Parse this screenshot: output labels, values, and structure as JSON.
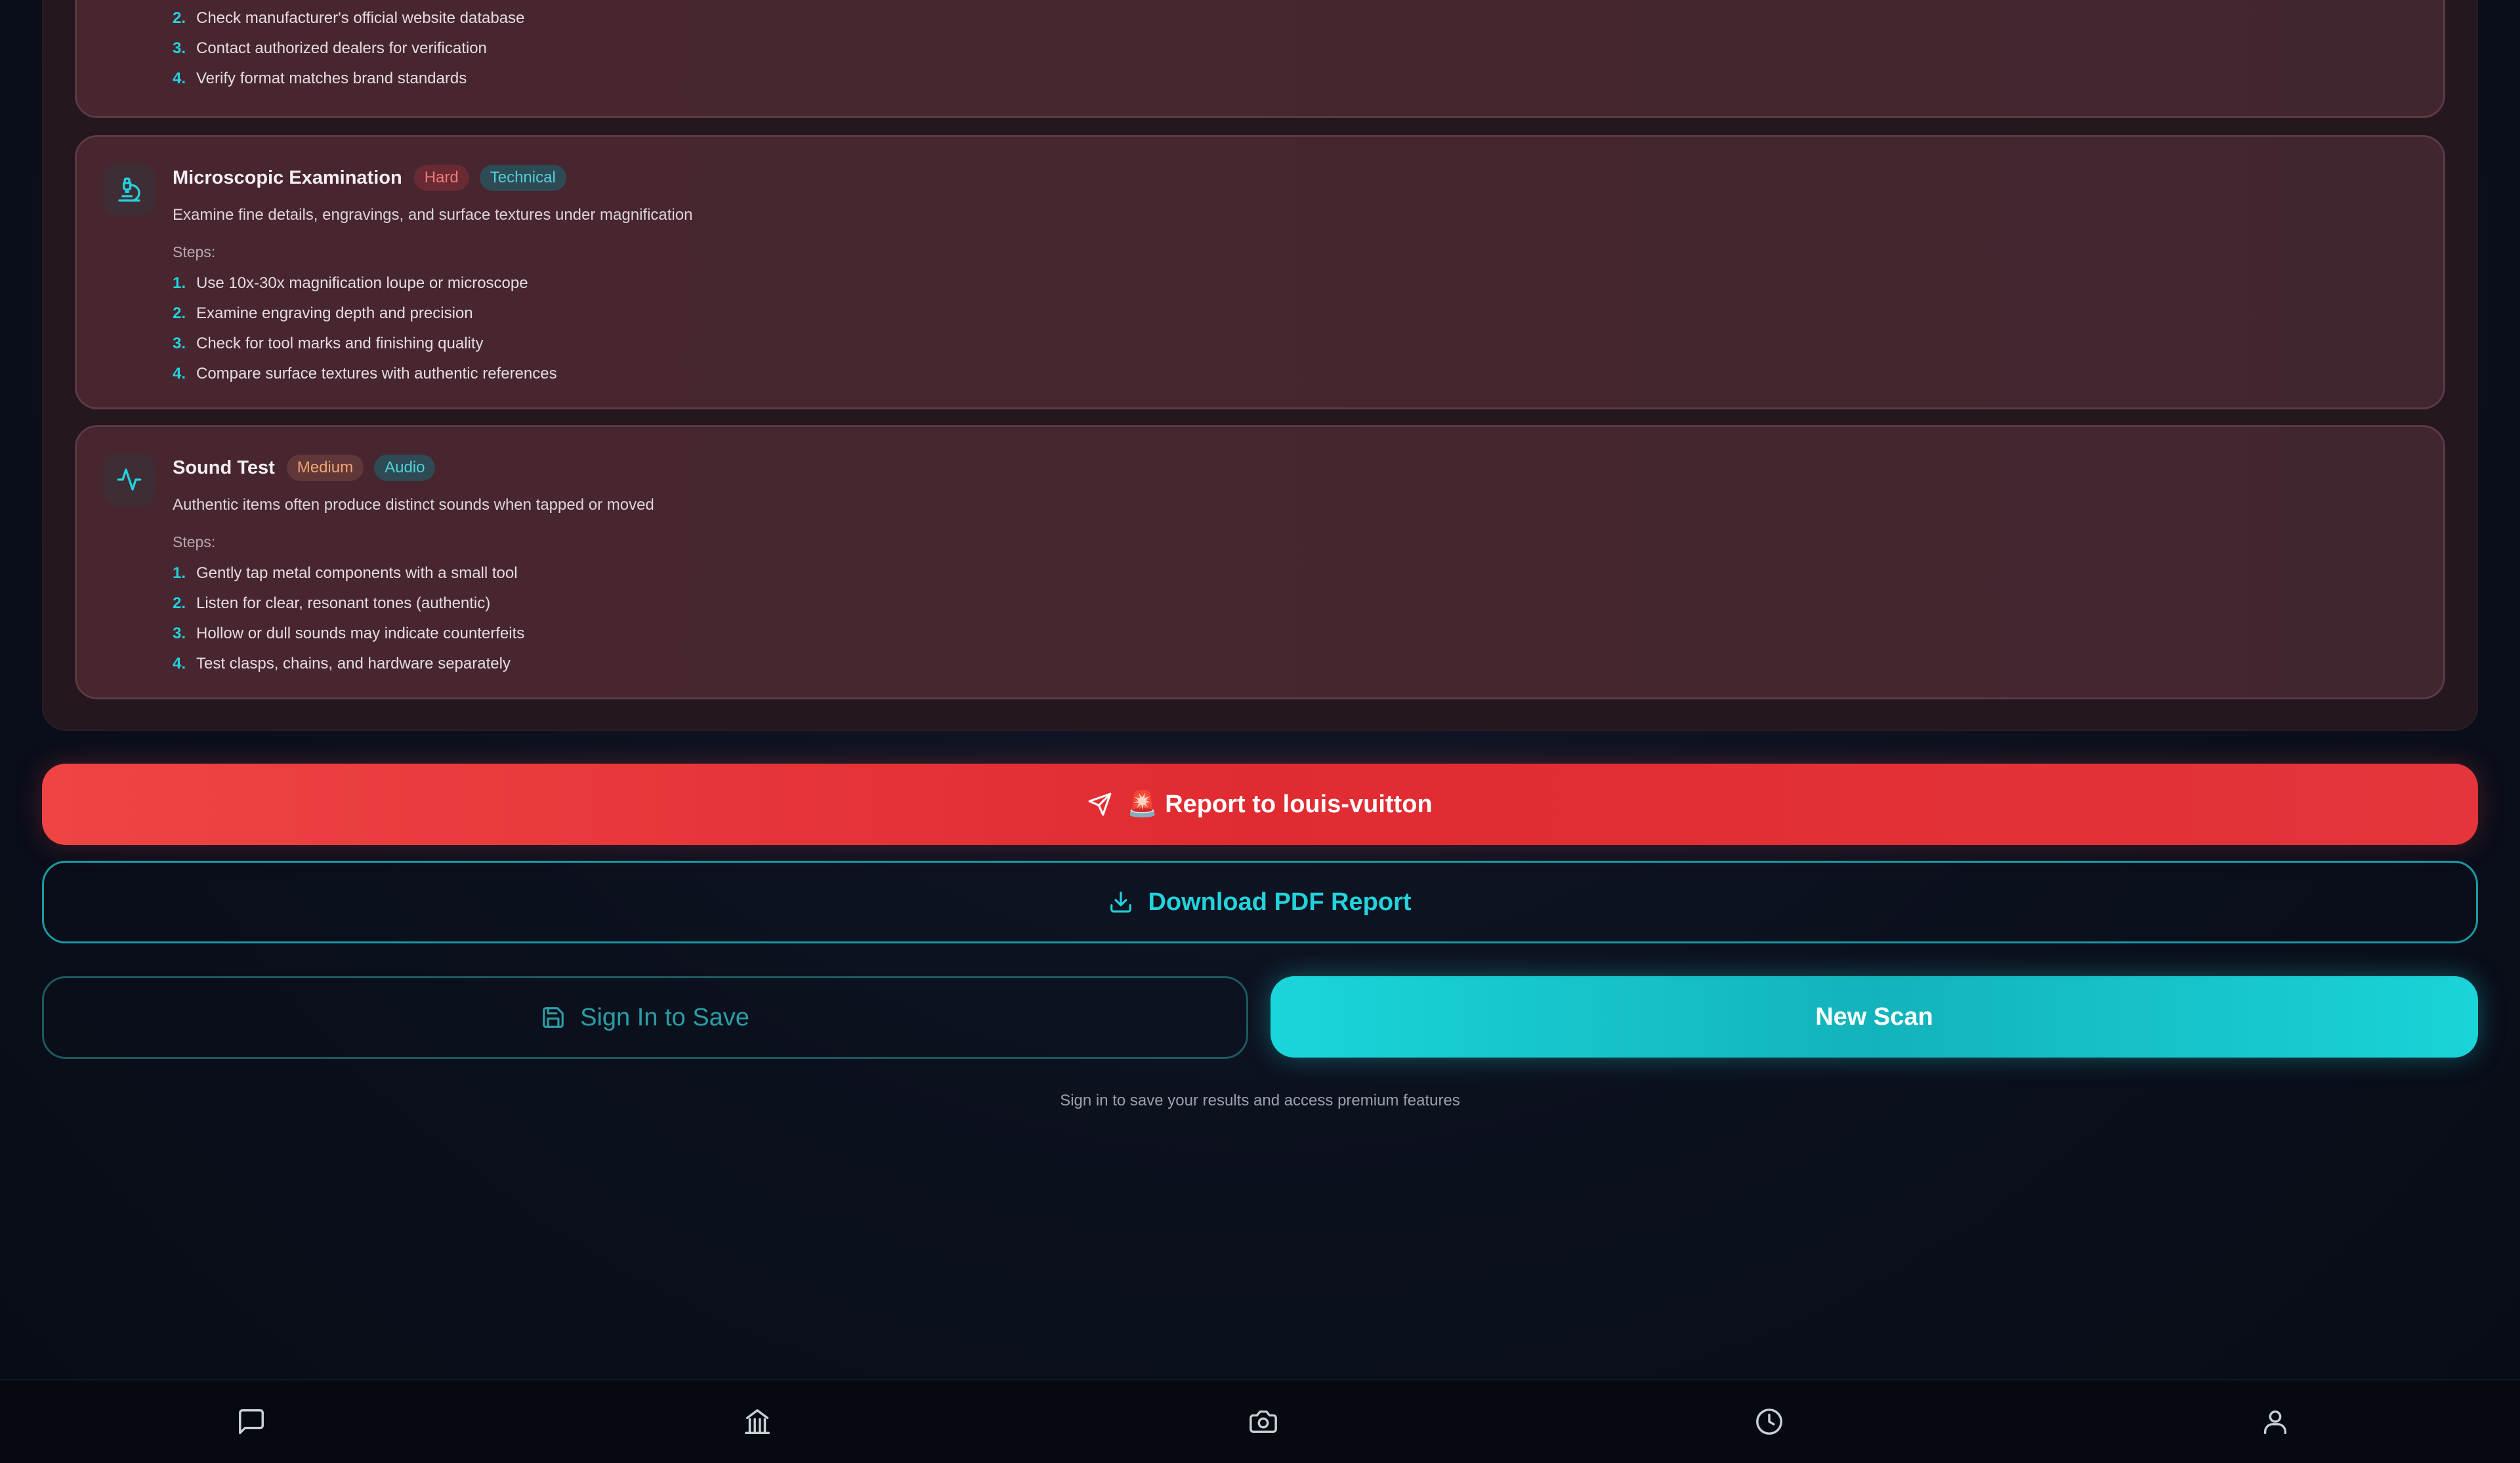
{
  "method_cards": [
    {
      "title": "",
      "steps": [
        {
          "num": "2.",
          "text": "Check manufacturer's official website database"
        },
        {
          "num": "3.",
          "text": "Contact authorized dealers for verification"
        },
        {
          "num": "4.",
          "text": "Verify format matches brand standards"
        }
      ]
    },
    {
      "title": "Microscopic Examination",
      "icon": "microscope-icon",
      "difficulty": "Hard",
      "category": "Technical",
      "description": "Examine fine details, engravings, and surface textures under magnification",
      "steps_label": "Steps:",
      "steps": [
        {
          "num": "1.",
          "text": "Use 10x-30x magnification loupe or microscope"
        },
        {
          "num": "2.",
          "text": "Examine engraving depth and precision"
        },
        {
          "num": "3.",
          "text": "Check for tool marks and finishing quality"
        },
        {
          "num": "4.",
          "text": "Compare surface textures with authentic references"
        }
      ]
    },
    {
      "title": "Sound Test",
      "icon": "activity-icon",
      "difficulty": "Medium",
      "category": "Audio",
      "description": "Authentic items often produce distinct sounds when tapped or moved",
      "steps_label": "Steps:",
      "steps": [
        {
          "num": "1.",
          "text": "Gently tap metal components with a small tool"
        },
        {
          "num": "2.",
          "text": "Listen for clear, resonant tones (authentic)"
        },
        {
          "num": "3.",
          "text": "Hollow or dull sounds may indicate counterfeits"
        },
        {
          "num": "4.",
          "text": "Test clasps, chains, and hardware separately"
        }
      ]
    }
  ],
  "actions": {
    "report_label": "🚨 Report to louis-vuitton",
    "download_label": "Download PDF Report",
    "signin_label": "Sign In to Save",
    "newscan_label": "New Scan",
    "signin_note": "Sign in to save your results and access premium features"
  },
  "bottom_nav": [
    {
      "icon": "chat-icon"
    },
    {
      "icon": "museum-icon"
    },
    {
      "icon": "camera-icon"
    },
    {
      "icon": "history-icon"
    },
    {
      "icon": "profile-icon"
    }
  ],
  "colors": {
    "accent": "#22d3dc",
    "danger": "#ef4444",
    "hard_badge": "#f07a7a",
    "medium_badge": "#f3a56e"
  }
}
